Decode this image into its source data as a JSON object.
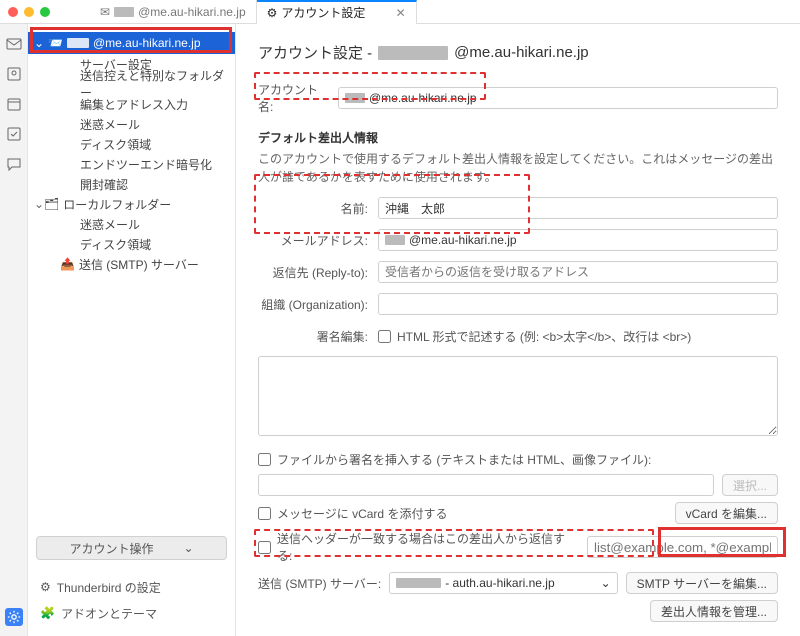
{
  "titlebar": {
    "tab1_suffix": "@me.au-hikari.ne.jp",
    "tab2": "アカウント設定"
  },
  "sidebar": {
    "account_suffix": "@me.au-hikari.ne.jp",
    "items": [
      "サーバー設定",
      "送信控えと特別なフォルダー",
      "編集とアドレス入力",
      "迷惑メール",
      "ディスク領域",
      "エンドツーエンド暗号化",
      "開封確認"
    ],
    "local": {
      "label": "ローカルフォルダー",
      "items": [
        "迷惑メール",
        "ディスク領域"
      ]
    },
    "smtp": "送信 (SMTP) サーバー",
    "ops": "アカウント操作",
    "footer": {
      "tb_settings": "Thunderbird の設定",
      "addons": "アドオンとテーマ"
    }
  },
  "content": {
    "h1_prefix": "アカウント設定 - ",
    "h1_suffix": "@me.au-hikari.ne.jp",
    "acct_name_label": "アカウント名:",
    "acct_name_suffix": "@me.au-hikari.ne.jp",
    "default_sender_title": "デフォルト差出人情報",
    "default_sender_desc": "このアカウントで使用するデフォルト差出人情報を設定してください。これはメッセージの差出人が誰であるかを表すために使用されます。",
    "name_label": "名前:",
    "name_value": "沖縄　太郎",
    "email_label": "メールアドレス:",
    "email_suffix": "@me.au-hikari.ne.jp",
    "reply_label": "返信先 (Reply-to):",
    "reply_placeholder": "受信者からの返信を受け取るアドレス",
    "org_label": "組織 (Organization):",
    "sig_label": "署名編集:",
    "sig_html": "HTML 形式で記述する (例: <b>太字</b>、改行は <br>)",
    "file_sig": "ファイルから署名を挿入する (テキストまたは HTML、画像ファイル):",
    "choose": "選択...",
    "vcard_check": "メッセージに vCard を添付する",
    "vcard_btn": "vCard を編集...",
    "header_check": "送信ヘッダーが一致する場合はこの差出人から返信する:",
    "header_placeholder": "list@example.com, *@example.com",
    "smtp_label": "送信 (SMTP) サーバー:",
    "smtp_value_suffix": " - auth.au-hikari.ne.jp",
    "smtp_edit": "SMTP サーバーを編集...",
    "manage_id": "差出人情報を管理..."
  }
}
